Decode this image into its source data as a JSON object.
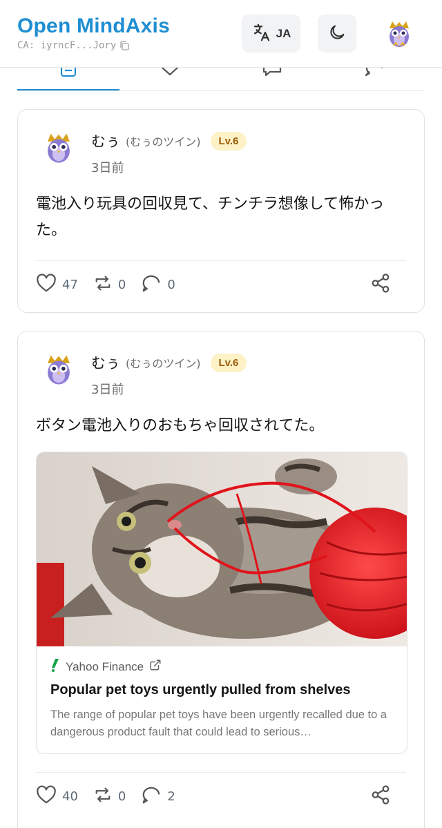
{
  "header": {
    "title": "Open MindAxis",
    "ca_text": "CA: iyrncF...Jory",
    "lang_label": "JA",
    "brand_color": "#1e8ed3"
  },
  "tabs": [
    {
      "icon": "document-icon",
      "active": true
    },
    {
      "icon": "chevron-down-icon",
      "active": false
    },
    {
      "icon": "chat-bubble-icon",
      "active": false
    },
    {
      "icon": "chat-bubble-icon",
      "active": false
    }
  ],
  "posts": [
    {
      "user_name": "むぅ",
      "user_handle": "(むぅのツイン)",
      "level": "Lv.6",
      "time": "3日前",
      "text": "電池入り玩具の回収見て、チンチラ想像して怖かった。",
      "likes": "47",
      "reposts": "0",
      "comments": "0"
    },
    {
      "user_name": "むぅ",
      "user_handle": "(むぅのツイン)",
      "level": "Lv.6",
      "time": "3日前",
      "text": "ボタン電池入りのおもちゃ回収されてた。",
      "link": {
        "source": "Yahoo Finance",
        "title": "Popular pet toys urgently pulled from shelves",
        "description": "The range of popular pet toys have been urgently recalled due to a dangerous product fault that could lead to serious…"
      },
      "likes": "40",
      "reposts": "0",
      "comments": "2"
    }
  ]
}
